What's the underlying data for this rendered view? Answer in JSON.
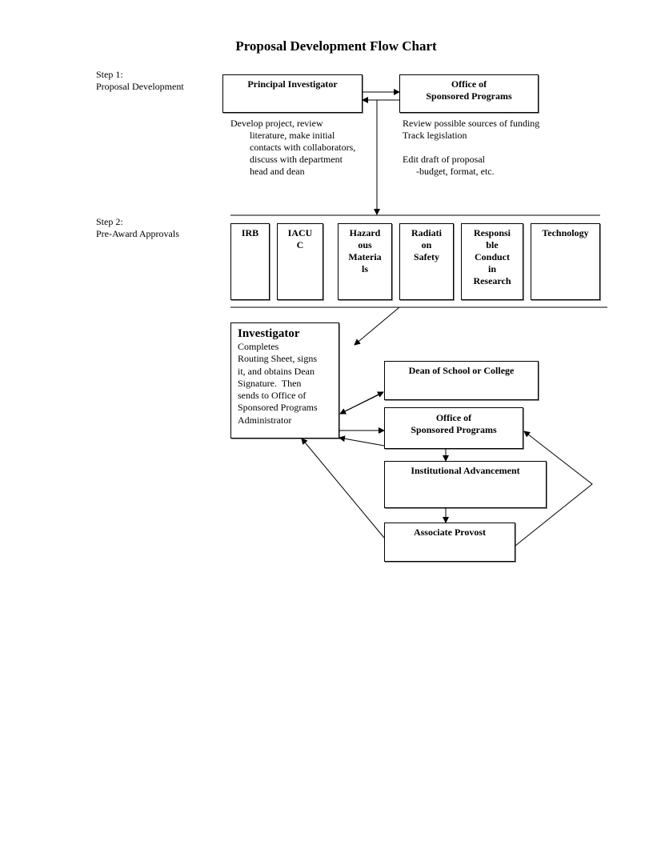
{
  "title": "Proposal Development Flow Chart",
  "step1": {
    "label_line1": "Step 1:",
    "label_line2": "Proposal Development",
    "principal_investigator": "Principal Investigator",
    "osp_line1": "Office of",
    "osp_line2": "Sponsored Programs",
    "pi_notes": [
      "Develop project, review",
      "literature, make initial",
      "contacts with collaborators,",
      "discuss with department",
      "head and dean"
    ],
    "osp_notes": [
      "Review possible sources of funding",
      "Track legislation",
      "",
      "Edit draft of proposal",
      "-budget, format, etc."
    ]
  },
  "step2": {
    "label_line1": "Step 2:",
    "label_line2": "Pre-Award Approvals",
    "approvals": [
      {
        "lines": [
          "IRB"
        ]
      },
      {
        "lines": [
          "IACU",
          "C"
        ]
      },
      {
        "lines": [
          "Hazard",
          "ous",
          "Materia",
          "ls"
        ]
      },
      {
        "lines": [
          "Radiati",
          "on",
          "Safety"
        ]
      },
      {
        "lines": [
          "Responsi",
          "ble",
          "Conduct",
          "in",
          "Research"
        ]
      },
      {
        "lines": [
          "Technology"
        ]
      }
    ]
  },
  "routing": {
    "investigator_title": "Investigator",
    "investigator_body": [
      "Completes",
      "Routing Sheet, signs",
      "it, and obtains Dean",
      "Signature.  Then",
      "sends to Office of",
      "Sponsored Programs",
      "Administrator"
    ],
    "dean": "Dean of School or College",
    "osp_line1": "Office of",
    "osp_line2": "Sponsored Programs",
    "institutional_advancement": "Institutional Advancement",
    "associate_provost": "Associate Provost"
  }
}
